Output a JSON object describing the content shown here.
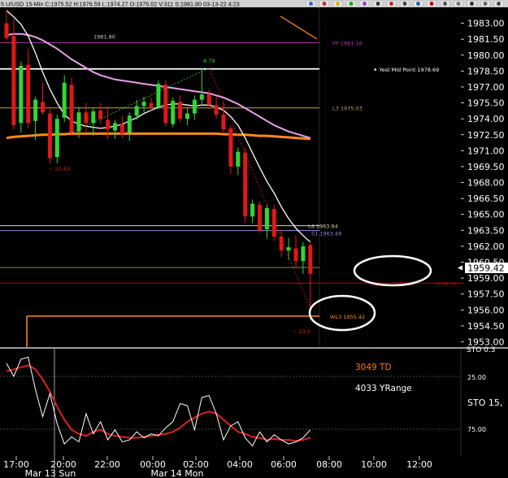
{
  "header": {
    "text": "U/USD  15-Min  C:1975.52 H:1976.59 L:1974.27 O:1975.02 V:311 S:1981.80 03-13-22 4:23",
    "c1": "5",
    "toolbar_icons": [
      "arrow-up-icon",
      "arrow-down-icon",
      "star-icon",
      "flag-icon",
      "leaf-icon",
      "text-icon",
      "circle-icon",
      "clock-icon",
      "target-icon",
      "red-square-icon",
      "tool-icon",
      "ruler-icon",
      "line-icon",
      "zoom-icon",
      "settings-icon"
    ]
  },
  "colors": {
    "bg": "#000000",
    "bull": "#33d633",
    "bear": "#e01818",
    "ma_fast": "#ffffff",
    "ma_slow": "#e8a0e8",
    "ma_long": "#ff8a1a",
    "stoch_k": "#ffffff",
    "stoch_d": "#e02020",
    "annotation_ellipse": "#ffffff"
  },
  "chart_data": [
    {
      "type": "candlestick",
      "ylim": [
        1952.5,
        1984.5
      ],
      "current_price": "1959.42",
      "y_ticks": [
        "1983.00",
        "1981.50",
        "1980.00",
        "1978.50",
        "1977.00",
        "1975.50",
        "1974.00",
        "1972.50",
        "1971.00",
        "1969.50",
        "1968.00",
        "1966.50",
        "1965.00",
        "1963.50",
        "1962.00",
        "1960.50",
        "1959.00",
        "1957.50",
        "1956.00",
        "1954.50",
        "1953.00"
      ],
      "candles": [
        {
          "o": 1983.0,
          "h": 1984.3,
          "l": 1981.4,
          "c": 1981.6
        },
        {
          "o": 1981.8,
          "h": 1983.4,
          "l": 1973.0,
          "c": 1973.4
        },
        {
          "o": 1973.6,
          "h": 1979.4,
          "l": 1972.7,
          "c": 1979.0
        },
        {
          "o": 1979.1,
          "h": 1980.6,
          "l": 1973.1,
          "c": 1973.6
        },
        {
          "o": 1973.8,
          "h": 1976.1,
          "l": 1972.0,
          "c": 1975.8
        },
        {
          "o": 1975.6,
          "h": 1977.4,
          "l": 1974.4,
          "c": 1974.6
        },
        {
          "o": 1974.5,
          "h": 1975.0,
          "l": 1969.8,
          "c": 1970.3
        },
        {
          "o": 1970.4,
          "h": 1974.4,
          "l": 1969.8,
          "c": 1974.0
        },
        {
          "o": 1974.1,
          "h": 1978.1,
          "l": 1973.7,
          "c": 1977.4
        },
        {
          "o": 1977.2,
          "h": 1977.9,
          "l": 1972.4,
          "c": 1972.7
        },
        {
          "o": 1972.8,
          "h": 1975.1,
          "l": 1972.2,
          "c": 1974.6
        },
        {
          "o": 1974.6,
          "h": 1975.5,
          "l": 1972.8,
          "c": 1973.6
        },
        {
          "o": 1973.6,
          "h": 1975.0,
          "l": 1972.4,
          "c": 1974.7
        },
        {
          "o": 1974.8,
          "h": 1975.5,
          "l": 1973.5,
          "c": 1974.0
        },
        {
          "o": 1973.9,
          "h": 1975.2,
          "l": 1972.1,
          "c": 1973.0
        },
        {
          "o": 1972.9,
          "h": 1973.9,
          "l": 1972.1,
          "c": 1973.6
        },
        {
          "o": 1973.5,
          "h": 1974.3,
          "l": 1972.2,
          "c": 1972.6
        },
        {
          "o": 1972.7,
          "h": 1974.6,
          "l": 1971.9,
          "c": 1974.3
        },
        {
          "o": 1974.3,
          "h": 1975.8,
          "l": 1973.9,
          "c": 1975.2
        },
        {
          "o": 1975.2,
          "h": 1976.1,
          "l": 1974.6,
          "c": 1975.6
        },
        {
          "o": 1975.5,
          "h": 1976.0,
          "l": 1974.8,
          "c": 1975.1
        },
        {
          "o": 1975.1,
          "h": 1977.6,
          "l": 1974.9,
          "c": 1977.3
        },
        {
          "o": 1977.2,
          "h": 1977.6,
          "l": 1973.3,
          "c": 1973.6
        },
        {
          "o": 1973.5,
          "h": 1976.0,
          "l": 1973.2,
          "c": 1975.7
        },
        {
          "o": 1975.6,
          "h": 1976.2,
          "l": 1973.7,
          "c": 1974.0
        },
        {
          "o": 1974.0,
          "h": 1975.0,
          "l": 1973.4,
          "c": 1974.5
        },
        {
          "o": 1974.5,
          "h": 1976.2,
          "l": 1973.9,
          "c": 1975.8
        },
        {
          "o": 1975.8,
          "h": 1978.8,
          "l": 1975.2,
          "c": 1976.3
        },
        {
          "o": 1976.3,
          "h": 1976.8,
          "l": 1974.9,
          "c": 1975.3
        },
        {
          "o": 1975.3,
          "h": 1976.1,
          "l": 1974.0,
          "c": 1974.4
        },
        {
          "o": 1974.4,
          "h": 1975.6,
          "l": 1972.6,
          "c": 1973.0
        },
        {
          "o": 1973.1,
          "h": 1973.4,
          "l": 1968.8,
          "c": 1969.5
        },
        {
          "o": 1969.5,
          "h": 1971.3,
          "l": 1968.7,
          "c": 1970.9
        },
        {
          "o": 1970.8,
          "h": 1971.3,
          "l": 1964.2,
          "c": 1964.8
        },
        {
          "o": 1964.8,
          "h": 1966.4,
          "l": 1964.2,
          "c": 1966.0
        },
        {
          "o": 1965.9,
          "h": 1966.2,
          "l": 1963.3,
          "c": 1963.5
        },
        {
          "o": 1963.6,
          "h": 1965.9,
          "l": 1962.7,
          "c": 1965.6
        },
        {
          "o": 1965.5,
          "h": 1965.9,
          "l": 1962.5,
          "c": 1962.9
        },
        {
          "o": 1962.9,
          "h": 1963.5,
          "l": 1961.0,
          "c": 1961.6
        },
        {
          "o": 1961.6,
          "h": 1962.8,
          "l": 1960.7,
          "c": 1961.9
        },
        {
          "o": 1961.8,
          "h": 1963.0,
          "l": 1960.0,
          "c": 1960.6
        },
        {
          "o": 1960.6,
          "h": 1962.4,
          "l": 1959.4,
          "c": 1962.0
        },
        {
          "o": 1962.1,
          "h": 1962.3,
          "l": 1956.2,
          "c": 1959.4
        }
      ],
      "ma_fast": [
        1984.2,
        1983.6,
        1982.9,
        1981.8,
        1980.2,
        1978.4,
        1976.8,
        1975.5,
        1974.4,
        1973.8,
        1973.5,
        1973.3,
        1973.2,
        1973.1,
        1973.2,
        1973.3,
        1973.5,
        1973.8,
        1974.1,
        1974.5,
        1974.8,
        1975.1,
        1975.3,
        1975.4,
        1975.4,
        1975.3,
        1975.2,
        1975.3,
        1975.3,
        1975.1,
        1974.8,
        1974.2,
        1973.4,
        1972.2,
        1970.8,
        1969.4,
        1968.1,
        1967.0,
        1965.7,
        1964.6,
        1963.7,
        1963.0,
        1962.4
      ],
      "ma_slow": [
        1981.9,
        1982.0,
        1982.0,
        1981.9,
        1981.7,
        1981.4,
        1981.0,
        1980.6,
        1980.1,
        1979.6,
        1979.2,
        1978.8,
        1978.4,
        1978.1,
        1977.9,
        1977.7,
        1977.6,
        1977.5,
        1977.4,
        1977.3,
        1977.2,
        1977.1,
        1977.0,
        1976.9,
        1976.8,
        1976.7,
        1976.6,
        1976.5,
        1976.4,
        1976.2,
        1976.0,
        1975.7,
        1975.4,
        1975.0,
        1974.6,
        1974.2,
        1973.8,
        1973.4,
        1973.1,
        1972.8,
        1972.6,
        1972.4,
        1972.2
      ],
      "ma_long": [
        1972.2,
        1972.3,
        1972.35,
        1972.4,
        1972.45,
        1972.5,
        1972.5,
        1972.55,
        1972.55,
        1972.6,
        1972.6,
        1972.6,
        1972.6,
        1972.6,
        1972.6,
        1972.6,
        1972.6,
        1972.6,
        1972.6,
        1972.6,
        1972.6,
        1972.6,
        1972.6,
        1972.6,
        1972.6,
        1972.6,
        1972.6,
        1972.6,
        1972.6,
        1972.6,
        1972.55,
        1972.55,
        1972.5,
        1972.5,
        1972.45,
        1972.4,
        1972.4,
        1972.35,
        1972.3,
        1972.25,
        1972.2,
        1972.15,
        1972.1
      ],
      "upper_trend": [
        [
          42,
          1983.3
        ],
        [
          48,
          1982.6
        ]
      ],
      "levels": [
        {
          "id": "pp",
          "value": 1981.16,
          "label": "PP 1981.16",
          "color": "#b03ab0",
          "from": 0
        },
        {
          "id": "white",
          "value": 1978.7,
          "label": "",
          "color": "#ffffff",
          "from": 0
        },
        {
          "id": "l3",
          "value": 1975.03,
          "label": "L3 1975.03",
          "color": "#c8a060",
          "from": 0
        },
        {
          "id": "l4",
          "value": 1963.94,
          "label": "L4 1963.94",
          "color": "#d8d8a0",
          "from": 0
        },
        {
          "id": "s1",
          "value": 1963.48,
          "label": "S1 1963.48",
          "color": "#8a8ad8",
          "from": 0
        },
        {
          "id": "wlow",
          "value": 1958.52,
          "label": "LW Low 1958.52",
          "color": "#c00000",
          "from": 0
        },
        {
          "id": "wl3",
          "value": 1955.42,
          "label": "WL3 1955.42",
          "color": "#ff8a1a",
          "from": 0.05
        }
      ],
      "annotations": {
        "yest_mid": "Yest Mid Point 1978.69",
        "high_label": "1981.80",
        "small_high": "8.79",
        "left_low": "~ 20.43",
        "bottom_low": "~ 23.0",
        "wlow_right": "1958.52"
      },
      "x_ticks": [
        "17:00",
        "20:00",
        "22:00",
        "00:00",
        "02:00",
        "04:00",
        "06:00",
        "08:00",
        "10:00",
        "12:00"
      ],
      "date_labels": [
        "Mar 13 Sun",
        "Mar 14 Mon"
      ]
    },
    {
      "type": "stochastic",
      "ylim": [
        0,
        100
      ],
      "labels": {
        "td": "3049 TD",
        "yrange": "4033 YRange",
        "sto": "STO 15,",
        "l25": "25.00",
        "l75": "75.00",
        "top_right": "STO 0.3"
      },
      "k": [
        12,
        25,
        8,
        6,
        38,
        65,
        42,
        72,
        92,
        85,
        90,
        62,
        82,
        70,
        88,
        78,
        90,
        88,
        80,
        86,
        82,
        84,
        76,
        70,
        52,
        54,
        78,
        46,
        44,
        62,
        88,
        74,
        70,
        86,
        94,
        80,
        90,
        83,
        88,
        92,
        90,
        86,
        78
      ],
      "d": [
        20,
        18,
        16,
        14,
        18,
        28,
        40,
        55,
        68,
        78,
        82,
        84,
        80,
        78,
        82,
        84,
        85,
        86,
        86,
        85,
        84,
        83,
        82,
        80,
        76,
        70,
        66,
        62,
        60,
        62,
        68,
        74,
        80,
        82,
        85,
        86,
        88,
        87,
        88,
        88,
        89,
        88,
        86
      ]
    }
  ]
}
